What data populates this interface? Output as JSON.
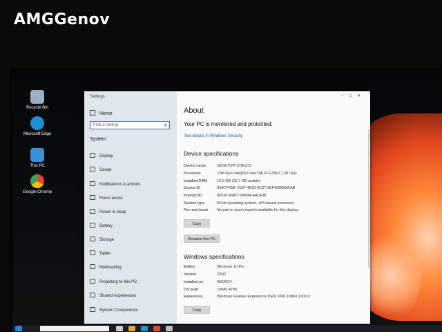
{
  "watermark": "AMGGenov",
  "desktop": {
    "icons": [
      {
        "label": "Recycle Bin",
        "icon": "recycle-bin-icon",
        "color": "#9ab0c4"
      },
      {
        "label": "Microsoft Edge",
        "icon": "edge-icon",
        "color": "#1f8fd6"
      },
      {
        "label": "This PC",
        "icon": "computer-icon",
        "color": "#3d8fd8"
      },
      {
        "label": "Google Chrome",
        "icon": "chrome-icon",
        "color": "#e94235"
      }
    ]
  },
  "settings": {
    "window_title": "Settings",
    "sidebar": {
      "home": "Home",
      "search_placeholder": "Find a setting",
      "section": "System",
      "items": [
        {
          "label": "Display",
          "icon": "display-icon"
        },
        {
          "label": "Sound",
          "icon": "sound-icon"
        },
        {
          "label": "Notifications & actions",
          "icon": "notifications-icon"
        },
        {
          "label": "Focus assist",
          "icon": "focus-assist-icon"
        },
        {
          "label": "Power & sleep",
          "icon": "power-icon"
        },
        {
          "label": "Battery",
          "icon": "battery-icon"
        },
        {
          "label": "Storage",
          "icon": "storage-icon"
        },
        {
          "label": "Tablet",
          "icon": "tablet-icon"
        },
        {
          "label": "Multitasking",
          "icon": "multitasking-icon"
        },
        {
          "label": "Projecting to this PC",
          "icon": "projecting-icon"
        },
        {
          "label": "Shared experiences",
          "icon": "shared-experiences-icon"
        },
        {
          "label": "System Components",
          "icon": "components-icon"
        }
      ]
    },
    "main": {
      "title": "About",
      "protection": "Your PC is monitored and protected.",
      "security_link": "See details in Windows Security",
      "device_heading": "Device specifications",
      "device_specs": [
        {
          "key": "Device name",
          "value": "DESKTOP-S7BKCS"
        },
        {
          "key": "Processor",
          "value": "12th Gen Intel(R) Core(TM) i5-1235U   1.30 GHz"
        },
        {
          "key": "Installed RAM",
          "value": "16.0 GB (15.7 GB usable)"
        },
        {
          "key": "Device ID",
          "value": "B3A7F65B-7A2F-4E15-9C37-5EF4D868A6AB"
        },
        {
          "key": "Product ID",
          "value": "00330-80417-84544-AAOEM"
        },
        {
          "key": "System type",
          "value": "64-bit operating system, x64-based processor"
        },
        {
          "key": "Pen and touch",
          "value": "No pen or touch input is available for this display"
        }
      ],
      "copy_label": "Copy",
      "rename_label": "Rename this PC",
      "windows_heading": "Windows specifications",
      "windows_specs": [
        {
          "key": "Edition",
          "value": "Windows 10 Pro"
        },
        {
          "key": "Version",
          "value": "22H2"
        },
        {
          "key": "Installed on",
          "value": "9/6/2024"
        },
        {
          "key": "OS build",
          "value": "19045.4780"
        },
        {
          "key": "Experience",
          "value": "Windows Feature Experience Pack 1000.19060.1000.0"
        }
      ],
      "copy2_label": "Copy"
    }
  },
  "taskbar": {
    "search_placeholder": "Type here to search"
  }
}
